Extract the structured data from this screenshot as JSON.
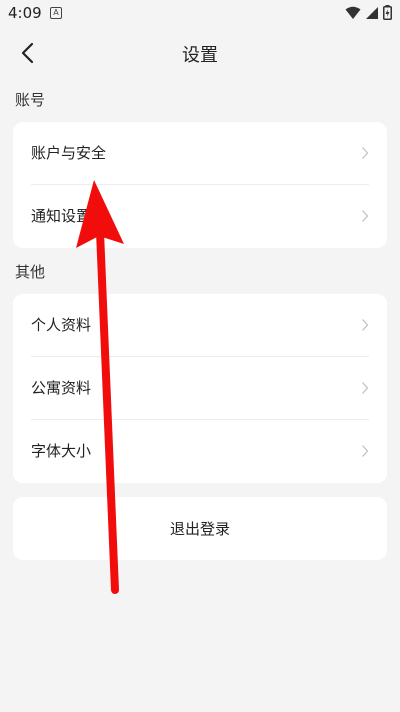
{
  "status_bar": {
    "time": "4:09",
    "notification_icon": "A",
    "icons": [
      "wifi-icon",
      "signal-icon",
      "battery-icon"
    ]
  },
  "header": {
    "title": "设置",
    "back_icon": "back-chevron-icon"
  },
  "sections": {
    "account": {
      "label": "账号",
      "items": [
        {
          "label": "账户与安全"
        },
        {
          "label": "通知设置"
        }
      ]
    },
    "other": {
      "label": "其他",
      "items": [
        {
          "label": "个人资料"
        },
        {
          "label": "公寓资料"
        },
        {
          "label": "字体大小"
        }
      ]
    }
  },
  "logout": {
    "label": "退出登录"
  },
  "colors": {
    "background": "#f4f4f4",
    "card": "#ffffff",
    "annotation_arrow": "#f20d0d",
    "chevron": "#c2c2c2"
  }
}
